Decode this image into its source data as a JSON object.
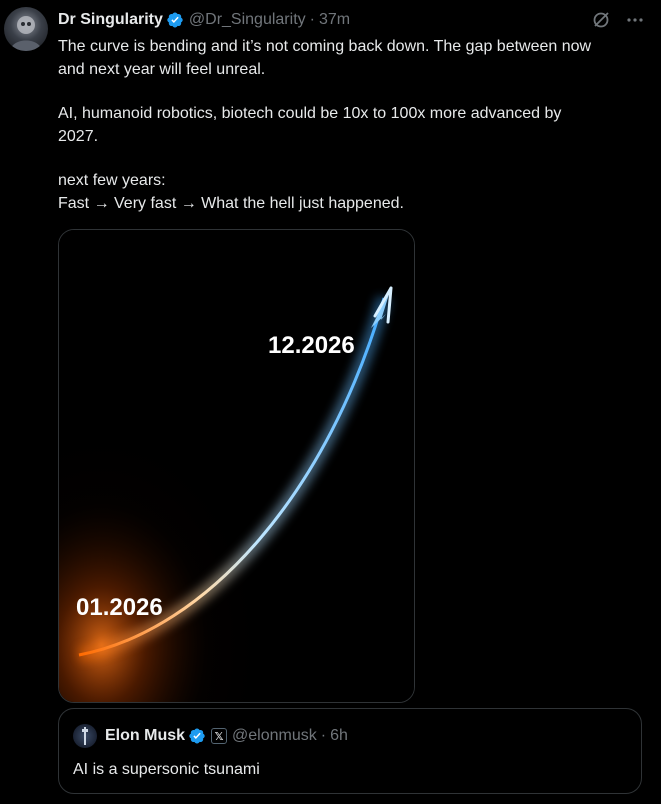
{
  "author": {
    "name": "Dr Singularity",
    "handle": "@Dr_Singularity",
    "separator": "·",
    "time": "37m"
  },
  "tweet": {
    "line1": "The curve is bending and it’s not coming back down. The gap between now",
    "line2": "and next year will feel unreal.",
    "line3": "AI, humanoid robotics, biotech could be 10x to 100x more advanced by",
    "line4": "2027.",
    "line5": "next few years:",
    "line6": "Fast → Very fast → What the hell just happened."
  },
  "media": {
    "label_start": "01.2026",
    "label_end": "12.2026"
  },
  "quoted": {
    "name": "Elon Musk",
    "handle": "@elonmusk",
    "separator": "·",
    "time": "6h",
    "text": "AI is a supersonic tsunami",
    "affiliate_badge": "𝕏"
  },
  "colors": {
    "verified": "#1d9bf0",
    "muted": "#71767b",
    "border": "#2f3336"
  },
  "icons": {
    "header_action_1": "grok-icon",
    "header_action_2": "more-icon"
  }
}
